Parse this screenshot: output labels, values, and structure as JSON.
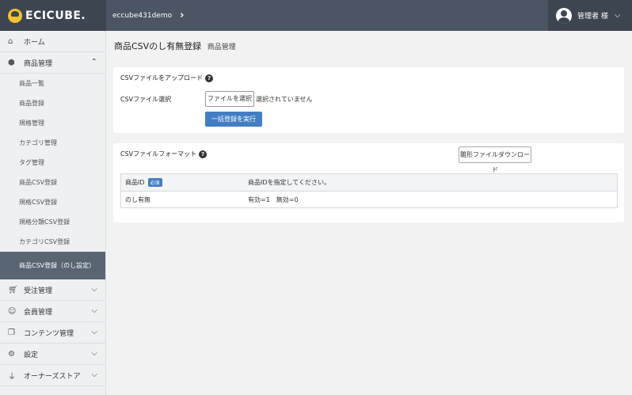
{
  "header": {
    "logo_text": "ECICUBE.",
    "shop_name": "eccube431demo",
    "user_name": "管理者 様"
  },
  "sidebar": {
    "home_label": "ホーム",
    "groups": [
      {
        "label": "商品管理",
        "expanded": true,
        "items": [
          {
            "label": "商品一覧"
          },
          {
            "label": "商品登録"
          },
          {
            "label": "規格管理"
          },
          {
            "label": "カテゴリ管理"
          },
          {
            "label": "タグ管理"
          },
          {
            "label": "商品CSV登録"
          },
          {
            "label": "規格CSV登録"
          },
          {
            "label": "規格分類CSV登録"
          },
          {
            "label": "カテゴリCSV登録"
          },
          {
            "label": "商品CSV登録（のし設定）",
            "active": true
          }
        ]
      },
      {
        "label": "受注管理"
      },
      {
        "label": "会員管理"
      },
      {
        "label": "コンテンツ管理"
      },
      {
        "label": "設定"
      },
      {
        "label": "オーナーズストア"
      }
    ]
  },
  "main": {
    "title": "商品CSVのし有無登録",
    "title_sub": "商品管理",
    "upload_card": {
      "title": "CSVファイルをアップロード",
      "field_label": "CSVファイル選択",
      "file_button": "ファイルを選択",
      "file_status": "選択されていません",
      "submit_button": "一括登録を実行"
    },
    "format_card": {
      "title": "CSVファイルフォーマット",
      "download_button": "雛形ファイルダウンロード",
      "rows": [
        {
          "name": "商品ID",
          "badge": "必須",
          "desc": "商品IDを指定してください。"
        },
        {
          "name": "のし有無",
          "badge": "",
          "desc": "有効=1　無効=0"
        }
      ]
    }
  }
}
